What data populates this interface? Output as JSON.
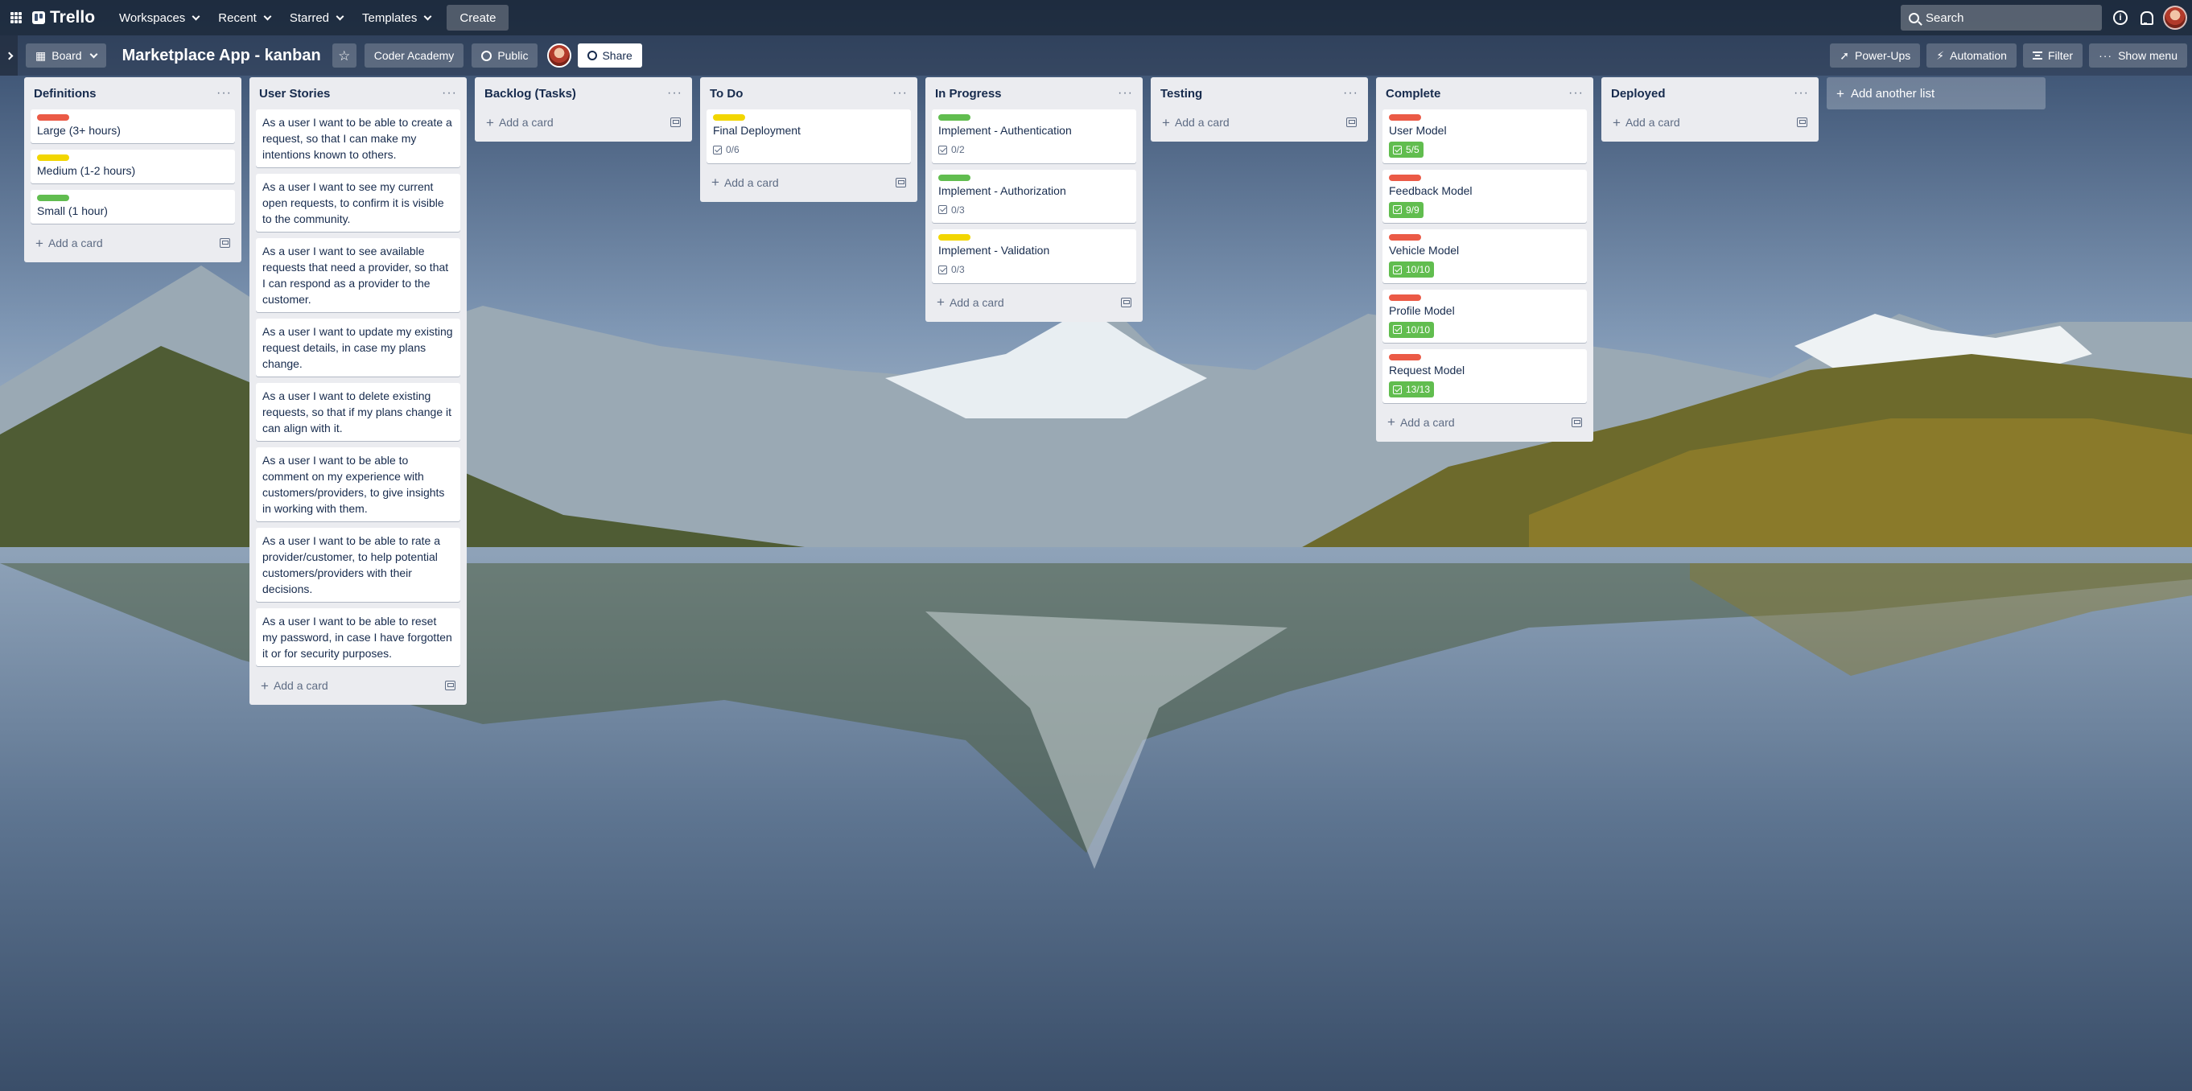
{
  "nav": {
    "logo": "Trello",
    "menus": [
      "Workspaces",
      "Recent",
      "Starred",
      "Templates"
    ],
    "create": "Create",
    "search_placeholder": "Search"
  },
  "board": {
    "view": "Board",
    "title": "Marketplace App - kanban",
    "workspace": "Coder Academy",
    "visibility": "Public",
    "share": "Share",
    "power_ups": "Power-Ups",
    "automation": "Automation",
    "filter": "Filter",
    "show_menu": "Show menu"
  },
  "add_card": "Add a card",
  "add_list": "Add another list",
  "lists": [
    {
      "title": "Definitions",
      "cards": [
        {
          "label": "red",
          "title": "Large (3+ hours)"
        },
        {
          "label": "yellow",
          "title": "Medium (1-2 hours)"
        },
        {
          "label": "green",
          "title": "Small (1 hour)"
        }
      ]
    },
    {
      "title": "User Stories",
      "cards": [
        {
          "title": "As a user I want to be able to create a request, so that I can make my intentions known to others."
        },
        {
          "title": "As a user I want to see my current open requests, to confirm it is visible to the community."
        },
        {
          "title": "As a user I want to see available requests that need a provider, so that I can respond as a provider to the customer."
        },
        {
          "title": "As a user I want to update my existing request details, in case my plans change."
        },
        {
          "title": "As a user I want to delete existing requests, so that if my plans change it can align with it."
        },
        {
          "title": "As a user I want to be able to comment on my experience with customers/providers, to give insights in working with them."
        },
        {
          "title": "As a user I want to be able to rate a provider/customer, to help potential customers/providers with their decisions."
        },
        {
          "title": "As a user I want to be able to reset my password, in case I have forgotten it or for security purposes."
        }
      ]
    },
    {
      "title": "Backlog (Tasks)",
      "cards": []
    },
    {
      "title": "To Do",
      "cards": [
        {
          "label": "yellow",
          "title": "Final Deployment",
          "checklist": "0/6",
          "complete": false
        }
      ]
    },
    {
      "title": "In Progress",
      "cards": [
        {
          "label": "green",
          "title": "Implement - Authentication",
          "checklist": "0/2",
          "complete": false
        },
        {
          "label": "green",
          "title": "Implement - Authorization",
          "checklist": "0/3",
          "complete": false
        },
        {
          "label": "yellow",
          "title": "Implement - Validation",
          "checklist": "0/3",
          "complete": false
        }
      ]
    },
    {
      "title": "Testing",
      "cards": []
    },
    {
      "title": "Complete",
      "cards": [
        {
          "label": "red",
          "title": "User Model",
          "checklist": "5/5",
          "complete": true
        },
        {
          "label": "red",
          "title": "Feedback Model",
          "checklist": "9/9",
          "complete": true
        },
        {
          "label": "red",
          "title": "Vehicle Model",
          "checklist": "10/10",
          "complete": true
        },
        {
          "label": "red",
          "title": "Profile Model",
          "checklist": "10/10",
          "complete": true
        },
        {
          "label": "red",
          "title": "Request Model",
          "checklist": "13/13",
          "complete": true
        }
      ]
    },
    {
      "title": "Deployed",
      "cards": []
    }
  ],
  "colors": {
    "label_red": "#eb5a46",
    "label_yellow": "#f2d600",
    "label_green": "#61bd4f",
    "list_bg": "#ebecf0",
    "text": "#172b4d"
  }
}
